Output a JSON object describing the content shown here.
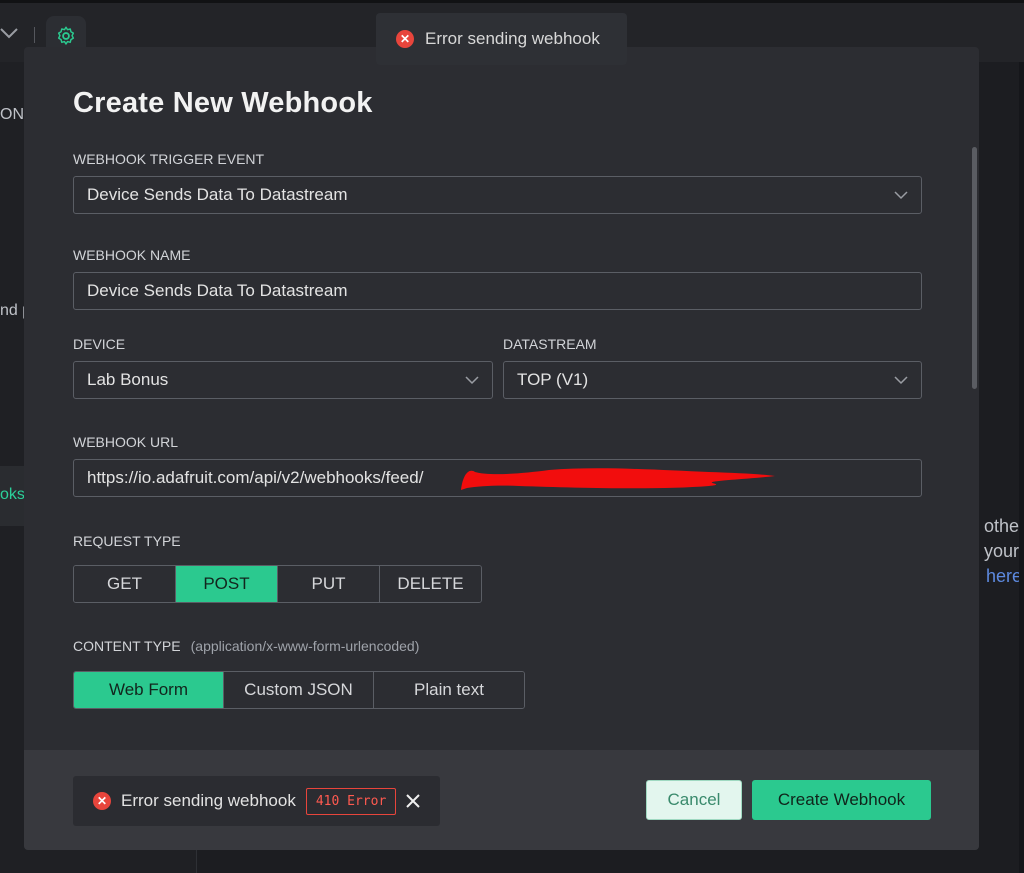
{
  "background": {
    "sidebar_fragments": [
      "ON",
      "nd p",
      "oks"
    ],
    "right_fragments": [
      "othe",
      "your",
      "here"
    ]
  },
  "toast_top": {
    "message": "Error sending webhook"
  },
  "modal": {
    "title": "Create New Webhook",
    "trigger_event": {
      "label": "WEBHOOK TRIGGER EVENT",
      "value": "Device Sends Data To Datastream"
    },
    "webhook_name": {
      "label": "WEBHOOK NAME",
      "value": "Device Sends Data To Datastream"
    },
    "device": {
      "label": "DEVICE",
      "value": "Lab Bonus"
    },
    "datastream": {
      "label": "DATASTREAM",
      "value": "TOP (V1)"
    },
    "webhook_url": {
      "label": "WEBHOOK URL",
      "value": "https://io.adafruit.com/api/v2/webhooks/feed/"
    },
    "request_type": {
      "label": "REQUEST TYPE",
      "options": [
        "GET",
        "POST",
        "PUT",
        "DELETE"
      ],
      "selected": "POST"
    },
    "content_type": {
      "label": "CONTENT TYPE",
      "hint": "(application/x-www-form-urlencoded)",
      "options": [
        "Web Form",
        "Custom JSON",
        "Plain text"
      ],
      "selected": "Web Form"
    }
  },
  "footer": {
    "toast": {
      "message": "Error sending webhook",
      "badge": "410 Error"
    },
    "cancel_label": "Cancel",
    "create_label": "Create Webhook"
  },
  "colors": {
    "accent": "#2bc98f",
    "error": "#e8453c",
    "background": "#1c1d21",
    "modal": "#2c2d32",
    "footer": "#38393e"
  },
  "icons": [
    "chevron-down-icon",
    "gear-icon",
    "error-icon",
    "close-icon"
  ]
}
